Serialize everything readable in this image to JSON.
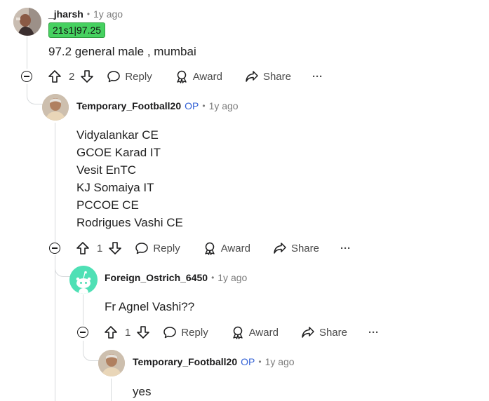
{
  "comments": [
    {
      "author": "_jharsh",
      "time": "1y ago",
      "flair": "21s1|97.25",
      "lines": [
        "97.2 general male , mumbai"
      ],
      "votes": "2",
      "op_badge": ""
    },
    {
      "author": "Temporary_Football20",
      "op_badge": "OP",
      "time": "1y ago",
      "lines": [
        "Vidyalankar CE",
        "GCOE Karad IT",
        "Vesit EnTC",
        "KJ Somaiya IT",
        "PCCOE CE",
        "Rodrigues Vashi CE"
      ],
      "votes": "1"
    },
    {
      "author": "Foreign_Ostrich_6450",
      "time": "1y ago",
      "lines": [
        "Fr Agnel Vashi??"
      ],
      "votes": "1",
      "op_badge": ""
    },
    {
      "author": "Temporary_Football20",
      "op_badge": "OP",
      "time": "1y ago",
      "lines": [
        "yes"
      ]
    }
  ],
  "actions": {
    "reply": "Reply",
    "award": "Award",
    "share": "Share",
    "more": "···"
  },
  "separator": "•",
  "colors": {
    "flair_bg": "#46d160",
    "op": "#3563d6",
    "snoo_bg": "#4fe0b5"
  },
  "icons": [
    "collapse-icon",
    "upvote-icon",
    "downvote-icon",
    "reply-icon",
    "award-icon",
    "share-icon",
    "more-icon",
    "snoo-avatar-icon"
  ]
}
